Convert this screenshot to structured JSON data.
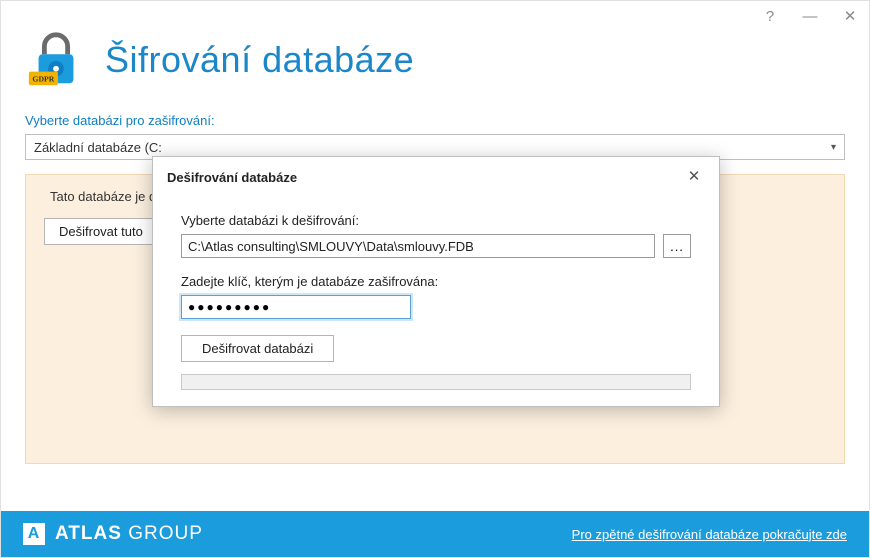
{
  "titlebar": {
    "help_glyph": "?",
    "minimize_glyph": "—",
    "close_glyph": "✕"
  },
  "header": {
    "title": "Šifrování databáze",
    "gdpr_label": "GDPR"
  },
  "main": {
    "select_label": "Vyberte databázi pro zašifrování:",
    "selected_db": "Základní databáze (C:",
    "panel_status": "Tato databáze je de",
    "decrypt_this_btn": "Dešifrovat tuto"
  },
  "modal": {
    "title": "Dešifrování databáze",
    "select_label": "Vyberte databázi k dešifrování:",
    "path_value": "C:\\Atlas consulting\\SMLOUVY\\Data\\smlouvy.FDB",
    "browse_label": "...",
    "key_label": "Zadejte klíč, kterým je databáze zašifrována:",
    "key_masked": "●●●●●●●●●",
    "decrypt_btn": "Dešifrovat databázi"
  },
  "footer": {
    "brand_bold": "ATLAS",
    "brand_light": " GROUP",
    "link": "Pro zpětné dešifrování databáze pokračujte zde"
  }
}
